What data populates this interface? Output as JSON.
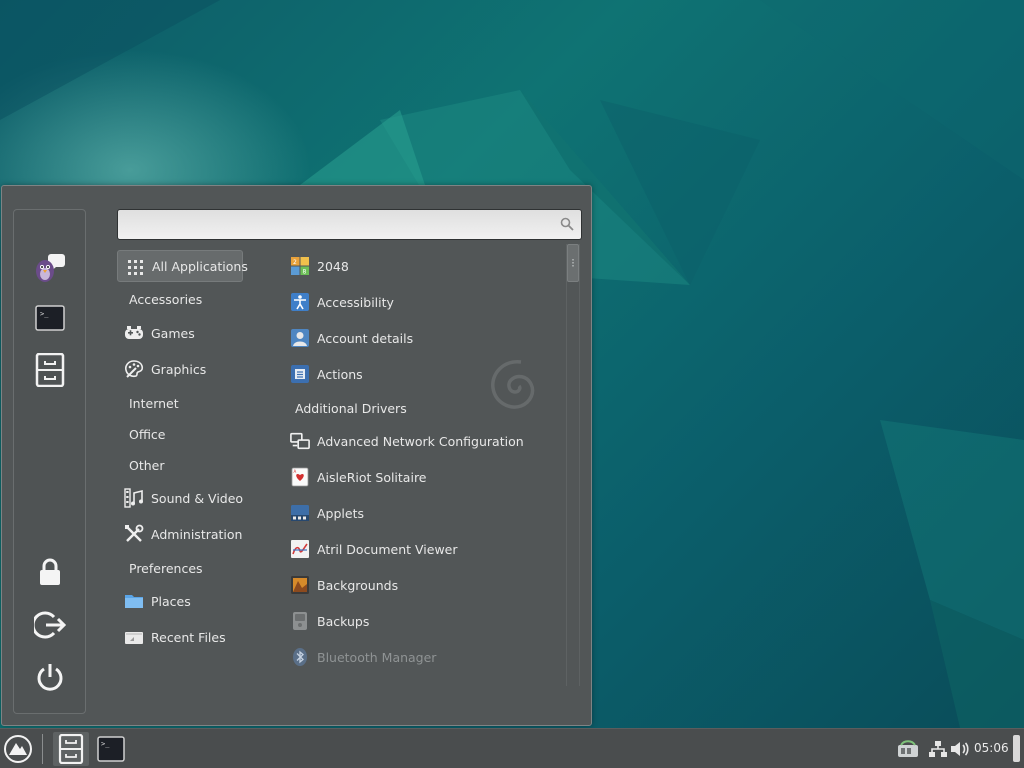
{
  "search": {
    "placeholder": "",
    "value": ""
  },
  "favorites": [
    {
      "icon": "pidgin-icon"
    },
    {
      "icon": "terminal-icon"
    },
    {
      "icon": "file-cabinet-icon"
    }
  ],
  "session_buttons": [
    {
      "icon": "lock-icon"
    },
    {
      "icon": "logout-icon"
    },
    {
      "icon": "power-icon"
    }
  ],
  "categories": [
    {
      "label": "All Applications",
      "icon": "grid-icon",
      "selected": true
    },
    {
      "label": "Accessories",
      "icon": null
    },
    {
      "label": "Games",
      "icon": "gamepad-icon"
    },
    {
      "label": "Graphics",
      "icon": "palette-icon"
    },
    {
      "label": "Internet",
      "icon": null
    },
    {
      "label": "Office",
      "icon": null
    },
    {
      "label": "Other",
      "icon": null
    },
    {
      "label": "Sound & Video",
      "icon": "film-music-icon"
    },
    {
      "label": "Administration",
      "icon": "tools-icon"
    },
    {
      "label": "Preferences",
      "icon": null
    },
    {
      "label": "Places",
      "icon": "folder-icon"
    },
    {
      "label": "Recent Files",
      "icon": "recent-files-icon"
    }
  ],
  "apps": [
    {
      "label": "2048",
      "icon": "2048-icon"
    },
    {
      "label": "Accessibility",
      "icon": "accessibility-icon"
    },
    {
      "label": "Account details",
      "icon": "user-icon"
    },
    {
      "label": "Actions",
      "icon": "actions-icon"
    },
    {
      "label": "Additional Drivers",
      "icon": null
    },
    {
      "label": "Advanced Network Configuration",
      "icon": "network-config-icon"
    },
    {
      "label": "AisleRiot Solitaire",
      "icon": "cards-icon"
    },
    {
      "label": "Applets",
      "icon": "applets-icon"
    },
    {
      "label": "Atril Document Viewer",
      "icon": "document-viewer-icon"
    },
    {
      "label": "Backgrounds",
      "icon": "backgrounds-icon"
    },
    {
      "label": "Backups",
      "icon": "backups-icon"
    },
    {
      "label": "Bluetooth Manager",
      "icon": "bluetooth-icon",
      "dimmed": true
    }
  ],
  "panel": {
    "menu_icon": "cinnamon-menu-icon",
    "launchers": [
      "file-cabinet-icon",
      "terminal-icon"
    ],
    "tray": [
      "update-manager-icon",
      "network-icon",
      "volume-icon"
    ],
    "clock": "05:06"
  }
}
